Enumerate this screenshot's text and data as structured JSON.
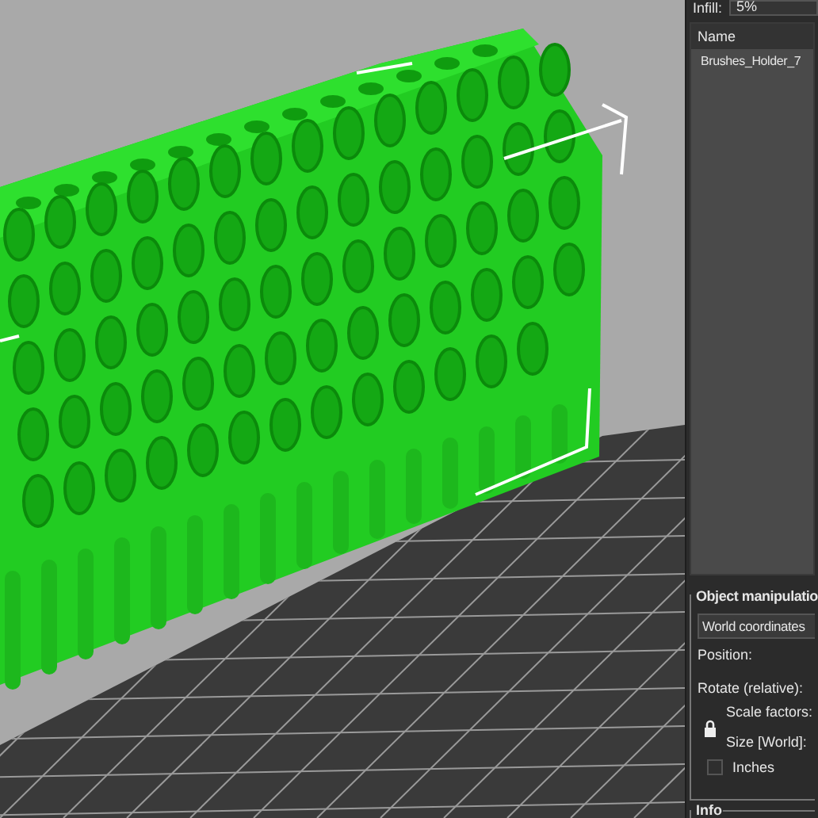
{
  "settings": {
    "infill_label": "Infill:",
    "infill_value": "5%"
  },
  "object_list": {
    "columns": [
      "Name"
    ],
    "rows": [
      {
        "name": "Brushes_Holder_7"
      }
    ]
  },
  "object_manipulation": {
    "title": "Object manipulatio",
    "coordinates": "World coordinates",
    "labels": [
      "Position:",
      "Rotate (relative):",
      "Scale factors:",
      "Size [World]:"
    ],
    "inches": {
      "label": "Inches",
      "checked": false
    }
  },
  "info": {
    "title": "Info"
  }
}
